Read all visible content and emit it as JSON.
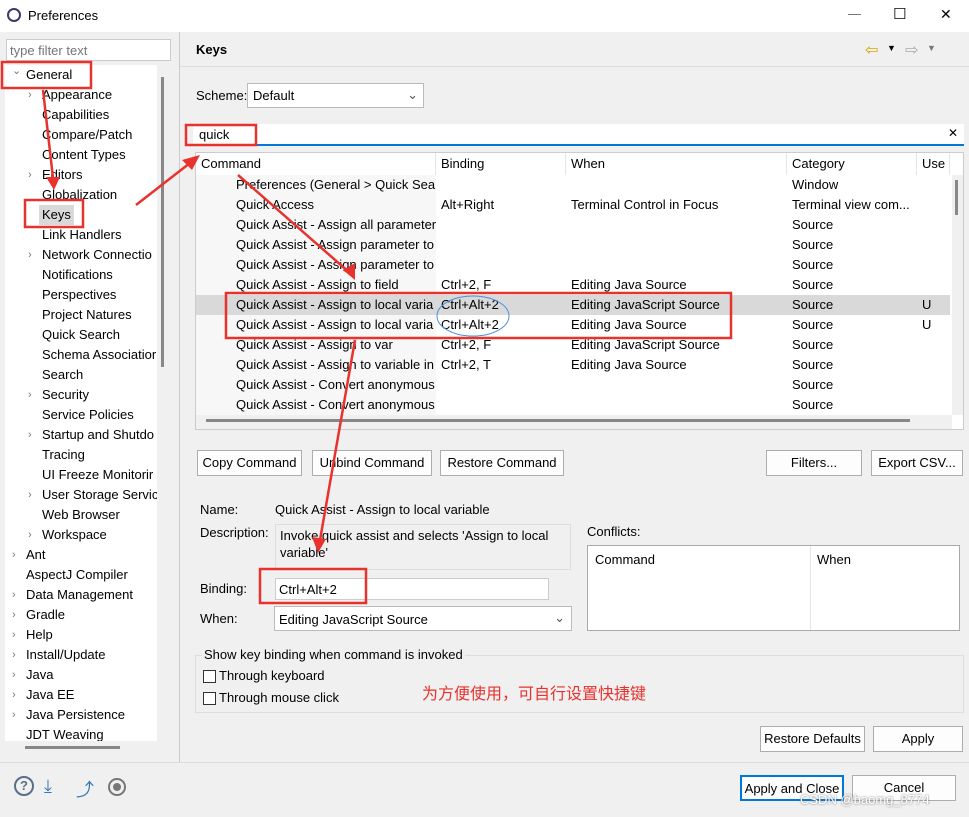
{
  "window": {
    "title": "Preferences",
    "minimize": "—",
    "maximize": "☐",
    "close": "✕"
  },
  "sidebar": {
    "filter_placeholder": "type filter text",
    "items": [
      {
        "label": "General",
        "level": 0,
        "arrow": "down"
      },
      {
        "label": "Appearance",
        "level": 1,
        "arrow": "right"
      },
      {
        "label": "Capabilities",
        "level": 1,
        "arrow": ""
      },
      {
        "label": "Compare/Patch",
        "level": 1,
        "arrow": ""
      },
      {
        "label": "Content Types",
        "level": 1,
        "arrow": ""
      },
      {
        "label": "Editors",
        "level": 1,
        "arrow": "right"
      },
      {
        "label": "Globalization",
        "level": 1,
        "arrow": ""
      },
      {
        "label": "Keys",
        "level": 1,
        "arrow": "",
        "selected": true
      },
      {
        "label": "Link Handlers",
        "level": 1,
        "arrow": ""
      },
      {
        "label": "Network Connectio",
        "level": 1,
        "arrow": "right"
      },
      {
        "label": "Notifications",
        "level": 1,
        "arrow": ""
      },
      {
        "label": "Perspectives",
        "level": 1,
        "arrow": ""
      },
      {
        "label": "Project Natures",
        "level": 1,
        "arrow": ""
      },
      {
        "label": "Quick Search",
        "level": 1,
        "arrow": ""
      },
      {
        "label": "Schema Associatior",
        "level": 1,
        "arrow": ""
      },
      {
        "label": "Search",
        "level": 1,
        "arrow": ""
      },
      {
        "label": "Security",
        "level": 1,
        "arrow": "right"
      },
      {
        "label": "Service Policies",
        "level": 1,
        "arrow": ""
      },
      {
        "label": "Startup and Shutdo",
        "level": 1,
        "arrow": "right"
      },
      {
        "label": "Tracing",
        "level": 1,
        "arrow": ""
      },
      {
        "label": "UI Freeze Monitorir",
        "level": 1,
        "arrow": ""
      },
      {
        "label": "User Storage Servic",
        "level": 1,
        "arrow": "right"
      },
      {
        "label": "Web Browser",
        "level": 1,
        "arrow": ""
      },
      {
        "label": "Workspace",
        "level": 1,
        "arrow": "right"
      },
      {
        "label": "Ant",
        "level": 0,
        "arrow": "right"
      },
      {
        "label": "AspectJ Compiler",
        "level": 0,
        "arrow": ""
      },
      {
        "label": "Data Management",
        "level": 0,
        "arrow": "right"
      },
      {
        "label": "Gradle",
        "level": 0,
        "arrow": "right"
      },
      {
        "label": "Help",
        "level": 0,
        "arrow": "right"
      },
      {
        "label": "Install/Update",
        "level": 0,
        "arrow": "right"
      },
      {
        "label": "Java",
        "level": 0,
        "arrow": "right"
      },
      {
        "label": "Java EE",
        "level": 0,
        "arrow": "right"
      },
      {
        "label": "Java Persistence",
        "level": 0,
        "arrow": "right"
      },
      {
        "label": "JDT Weaving",
        "level": 0,
        "arrow": ""
      }
    ]
  },
  "page": {
    "title": "Keys",
    "scheme_label": "Scheme:",
    "scheme_value": "Default",
    "search_value": "quick",
    "columns": [
      "Command",
      "Binding",
      "When",
      "Category",
      "Use"
    ],
    "rows": [
      [
        "Preferences (General > Quick Sear",
        "",
        "",
        "Window",
        ""
      ],
      [
        "Quick Access",
        "Alt+Right",
        "Terminal Control in Focus",
        "Terminal view com...",
        ""
      ],
      [
        "Quick Assist - Assign all parameter",
        "",
        "",
        "Source",
        ""
      ],
      [
        "Quick Assist - Assign parameter to",
        "",
        "",
        "Source",
        ""
      ],
      [
        "Quick Assist - Assign parameter to",
        "",
        "",
        "Source",
        ""
      ],
      [
        "Quick Assist - Assign to field",
        "Ctrl+2, F",
        "Editing Java Source",
        "Source",
        ""
      ],
      [
        "Quick Assist - Assign to local varia",
        "Ctrl+Alt+2",
        "Editing JavaScript Source",
        "Source",
        "U"
      ],
      [
        "Quick Assist - Assign to local varia",
        "Ctrl+Alt+2",
        "Editing Java Source",
        "Source",
        "U"
      ],
      [
        "Quick Assist - Assign to var",
        "Ctrl+2, F",
        "Editing JavaScript Source",
        "Source",
        ""
      ],
      [
        "Quick Assist - Assign to variable in",
        "Ctrl+2, T",
        "Editing Java Source",
        "Source",
        ""
      ],
      [
        "Quick Assist - Convert anonymous",
        "",
        "",
        "Source",
        ""
      ],
      [
        "Quick Assist - Convert anonymous",
        "",
        "",
        "Source",
        ""
      ]
    ],
    "selected_row": 6,
    "buttons": {
      "copy": "Copy Command",
      "unbind": "Unbind Command",
      "restore": "Restore Command",
      "filters": "Filters...",
      "export": "Export CSV..."
    },
    "name_label": "Name:",
    "name_value": "Quick Assist - Assign to local variable",
    "desc_label": "Description:",
    "desc_value": "Invoke quick assist and selects 'Assign to local variable'",
    "binding_label": "Binding:",
    "binding_value": "Ctrl+Alt+2",
    "when_label": "When:",
    "when_value": "Editing JavaScript Source",
    "conflicts_label": "Conflicts:",
    "conflicts_cols": [
      "Command",
      "When"
    ],
    "show_group": "Show key binding when command is invoked",
    "through_keyboard": "Through keyboard",
    "through_mouse": "Through mouse click",
    "restore_defaults": "Restore Defaults",
    "apply": "Apply"
  },
  "footer": {
    "apply_close": "Apply and Close",
    "cancel": "Cancel"
  },
  "annotation": {
    "text": "为方便使用，可自行设置快捷键",
    "color": "#e8322d"
  },
  "watermark": "CSDN @baomg_8774"
}
